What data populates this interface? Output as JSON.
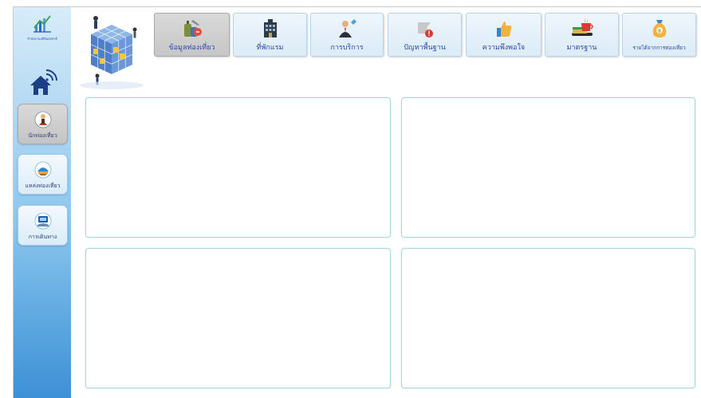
{
  "sidebar": {
    "logo_text": "สำนักงานสถิติแห่งชาติ",
    "items": [
      {
        "label": "นักท่องเที่ยว",
        "icon": "tourist-icon"
      },
      {
        "label": "แหล่งท่องเที่ยว",
        "icon": "attraction-icon"
      },
      {
        "label": "การเดินทาง",
        "icon": "travel-icon"
      }
    ]
  },
  "tabs": [
    {
      "label": "ข้อมูลท่องเที่ยว",
      "icon": "luggage-icon"
    },
    {
      "label": "ที่พักแรม",
      "icon": "hotel-icon"
    },
    {
      "label": "การบริการ",
      "icon": "service-staff-icon"
    },
    {
      "label": "ปัญหาพื้นฐาน",
      "icon": "warning-icon"
    },
    {
      "label": "ความพึงพอใจ",
      "icon": "thumbs-up-icon"
    },
    {
      "label": "มาตรฐาน",
      "icon": "tea-cup-icon"
    },
    {
      "label": "รายได้จากการท่องเที่ยว",
      "icon": "money-bag-icon"
    }
  ],
  "colors": {
    "accent": "#2b4aa3",
    "sidebar_top": "#d8ecf9",
    "sidebar_bottom": "#3d90d6",
    "panel_border": "#a9d7d9"
  }
}
